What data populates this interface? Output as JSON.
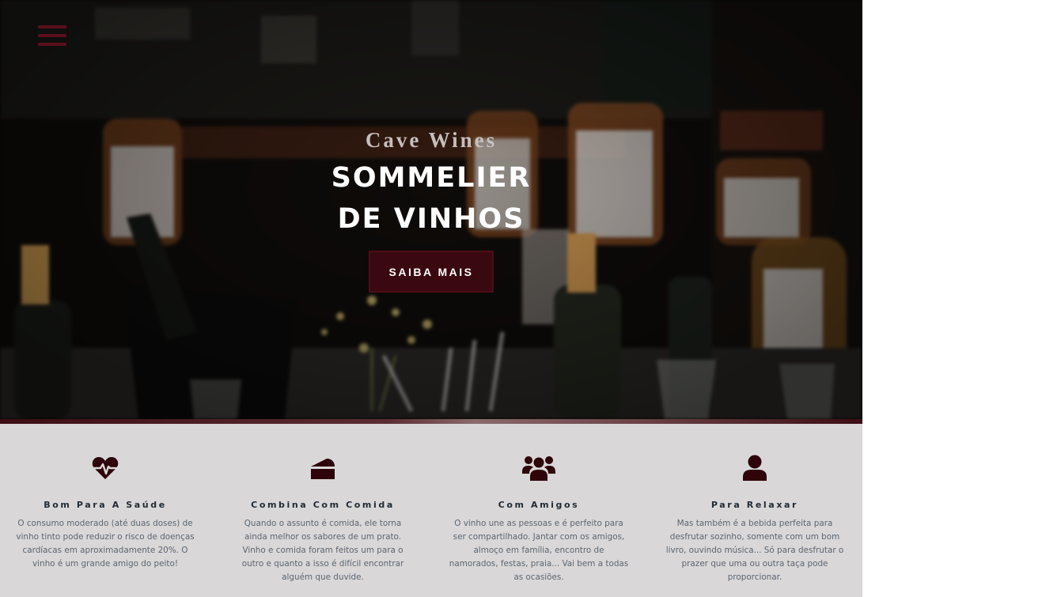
{
  "hero": {
    "brand": "Cave Wines",
    "headline_line1": "SOMMELIER",
    "headline_line2": "DE VINHOS",
    "cta_label": "SAIBA MAIS",
    "menu_icon": "hamburger-menu-icon"
  },
  "colors": {
    "accent": "#3a0810",
    "icon": "#2e0309",
    "features_bg": "#d9d7d8"
  },
  "features": [
    {
      "icon": "heartbeat-icon",
      "title": "Bom Para A Saúde",
      "text": "O consumo moderado (até duas doses) de vinho tinto pode reduzir o risco de doenças cardíacas em aproximadamente 20%. O vinho é um grande amigo do peito!"
    },
    {
      "icon": "cake-slice-icon",
      "title": "Combina Com Comida",
      "text": "Quando o assunto é comida, ele torna ainda melhor os sabores de um prato. Vinho e comida foram feitos um para o outro e quanto a isso é difícil encontrar alguém que duvide."
    },
    {
      "icon": "users-icon",
      "title": "Com Amigos",
      "text": "O vinho une as pessoas e é perfeito para ser compartilhado. Jantar com os amigos, almoço em família, encontro de namorados, festas, praia... Vai bem a todas as ocasiões."
    },
    {
      "icon": "user-icon",
      "title": "Para Relaxar",
      "text": "Mas também é a bebida perfeita para desfrutar sozinho, somente com um bom livro, ouvindo música... Só para desfrutar o prazer que uma ou outra taça pode proporcionar."
    }
  ]
}
